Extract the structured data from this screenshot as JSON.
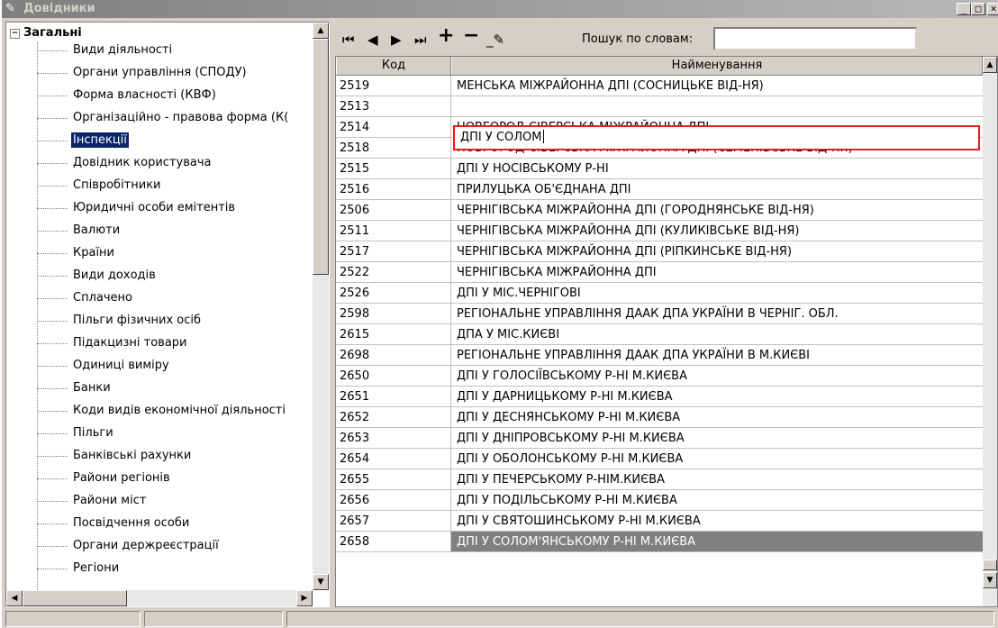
{
  "window": {
    "title": "Довідники",
    "controls": {
      "minimize": "_",
      "maximize": "□",
      "close": "×"
    }
  },
  "tree": {
    "root_label": "Загальні",
    "items": [
      {
        "label": "Види діяльності"
      },
      {
        "label": "Органи управління (СПОДУ)"
      },
      {
        "label": "Форма власності (КВФ)"
      },
      {
        "label": "Організаційно - правова форма (К("
      },
      {
        "label": "Інспекції",
        "selected": true
      },
      {
        "label": "Довідник користувача"
      },
      {
        "label": "Співробітники"
      },
      {
        "label": "Юридичні особи емітентів"
      },
      {
        "label": "Валюти"
      },
      {
        "label": "Країни"
      },
      {
        "label": "Види доходів"
      },
      {
        "label": "Сплачено"
      },
      {
        "label": "Пільги фізичних осіб"
      },
      {
        "label": "Підакцизні товари"
      },
      {
        "label": "Одиниці виміру"
      },
      {
        "label": "Банки"
      },
      {
        "label": "Коди видів економічної діяльності"
      },
      {
        "label": "Пільги"
      },
      {
        "label": "Банківські рахунки"
      },
      {
        "label": "Райони регіонів"
      },
      {
        "label": "Райони міст"
      },
      {
        "label": "Посвідчення особи"
      },
      {
        "label": "Органи держреєстрації"
      },
      {
        "label": "Регіони"
      }
    ]
  },
  "toolbar": {
    "first_icon": "first-record-icon",
    "prev_icon": "prev-record-icon",
    "next_icon": "next-record-icon",
    "last_icon": "last-record-icon",
    "add_icon": "add-record-icon",
    "delete_icon": "delete-record-icon",
    "edit_icon": "edit-record-icon",
    "search_label": "Пошук по словам:",
    "search_value": ""
  },
  "grid": {
    "columns": {
      "code": "Код",
      "name": "Найменування"
    },
    "editing_value": "ДПІ У СОЛОМ",
    "rows": [
      {
        "code": "2519",
        "name": "МЕНСЬКА МІЖРАЙОННА ДПІ (СОСНИЦЬКЕ ВІД-НЯ)"
      },
      {
        "code": "2513",
        "name": ""
      },
      {
        "code": "2514",
        "name": "НОВГОРОД-СІВЕРСЬКА МІЖРАЙОННА ДПІ"
      },
      {
        "code": "2518",
        "name": "НОВГОРОД-СІВЕРСЬКА МІЖРАЙОННА ДПІ (СЕМЕНІВСЬКЕ ВІД-НЯ)"
      },
      {
        "code": "2515",
        "name": "ДПІ У НОСІВСЬКОМУ Р-НІ"
      },
      {
        "code": "2516",
        "name": "ПРИЛУЦЬКА ОБ'ЄДНАНА ДПІ"
      },
      {
        "code": "2506",
        "name": "ЧЕРНІГІВСЬКА МІЖРАЙОННА ДПІ  (ГОРОДНЯНСЬКЕ ВІД-НЯ)"
      },
      {
        "code": "2511",
        "name": "ЧЕРНІГІВСЬКА МІЖРАЙОННА ДПІ (КУЛИКІВСЬКЕ ВІД-НЯ)"
      },
      {
        "code": "2517",
        "name": "ЧЕРНІГІВСЬКА МІЖРАЙОННА ДПІ (РІПКИНСЬКЕ ВІД-НЯ)"
      },
      {
        "code": "2522",
        "name": "ЧЕРНІГІВСЬКА  МІЖРАЙОННА ДПІ"
      },
      {
        "code": "2526",
        "name": "ДПІ У МІС.ЧЕРНІГОВІ"
      },
      {
        "code": "2598",
        "name": "РЕГІОНАЛЬНЕ УПРАВЛІННЯ ДААК ДПА УКРАЇНИ В ЧЕРНІГ. ОБЛ."
      },
      {
        "code": "2615",
        "name": "ДПА У МІС.КИЄВІ"
      },
      {
        "code": "2698",
        "name": "РЕГІОНАЛЬНЕ УПРАВЛІННЯ ДААК ДПА УКРАЇНИ В М.КИЄВІ"
      },
      {
        "code": "2650",
        "name": "ДПІ У ГОЛОСІЇВСЬКОМУ Р-НІ  М.КИЄВА"
      },
      {
        "code": "2651",
        "name": "ДПІ У ДАРНИЦЬКОМУ Р-НІ М.КИЄВА"
      },
      {
        "code": "2652",
        "name": "ДПІ У ДЕСНЯНСЬКОМУ Р-НІ М.КИЄВА"
      },
      {
        "code": "2653",
        "name": "ДПІ У ДНІПРОВСЬКОМУ Р-НІ М.КИЄВА"
      },
      {
        "code": "2654",
        "name": "ДПІ У ОБОЛОНСЬКОМУ Р-НІ М.КИЄВА"
      },
      {
        "code": "2655",
        "name": "ДПІ У ПЕЧЕРСЬКОМУ Р-НІМ.КИЄВА"
      },
      {
        "code": "2656",
        "name": "ДПІ У ПОДІЛЬСЬКОМУ Р-НІ М.КИЄВА"
      },
      {
        "code": "2657",
        "name": "ДПІ У СВЯТОШИНСЬКОМУ Р-НІ М.КИЄВА"
      },
      {
        "code": "2658",
        "name": "ДПІ У СОЛОМ'ЯНСЬКОМУ Р-НІ М.КИЄВА",
        "current": true
      }
    ]
  },
  "colors": {
    "selection": "#0a246a",
    "edit_border": "#e0201a",
    "current_row": "#808080"
  }
}
